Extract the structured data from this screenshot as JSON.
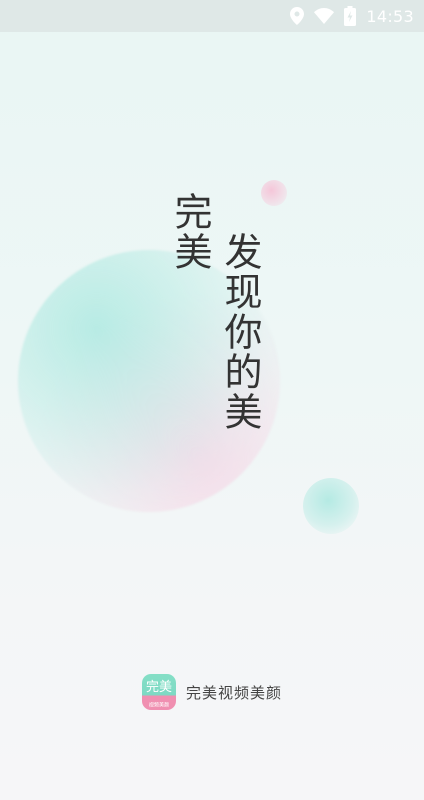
{
  "status_bar": {
    "time": "14:53",
    "icons": [
      "location-icon",
      "wifi-icon",
      "battery-icon"
    ]
  },
  "splash": {
    "brand_vertical": "完美",
    "tagline_vertical": "发现你的美"
  },
  "footer": {
    "app_icon_main": "完美",
    "app_icon_sub": "视频美颜",
    "app_name": "完美视频美颜"
  },
  "colors": {
    "text": "#333333",
    "accent_mint": "#84dfc6",
    "accent_pink": "#f08fb1"
  }
}
